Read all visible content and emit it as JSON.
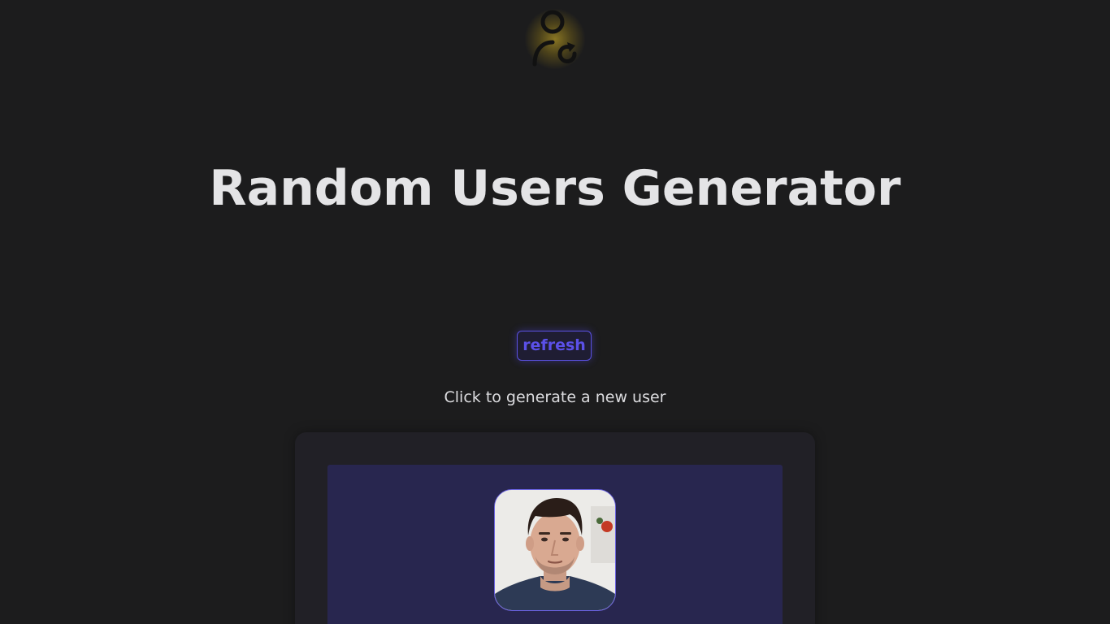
{
  "header": {
    "logo_icon": "user-refresh-icon",
    "title": "Random Users Generator"
  },
  "controls": {
    "refresh_label": "refresh",
    "hint": "Click to generate a new user"
  },
  "user_card": {
    "avatar_icon": "user-portrait-photo"
  },
  "colors": {
    "background": "#1c1c1d",
    "title_text": "#e4e4e6",
    "accent": "#5b50e8",
    "logo_glow": "#e1be28",
    "card_bg": "#212026",
    "card_inner_bg": "#28264f"
  }
}
